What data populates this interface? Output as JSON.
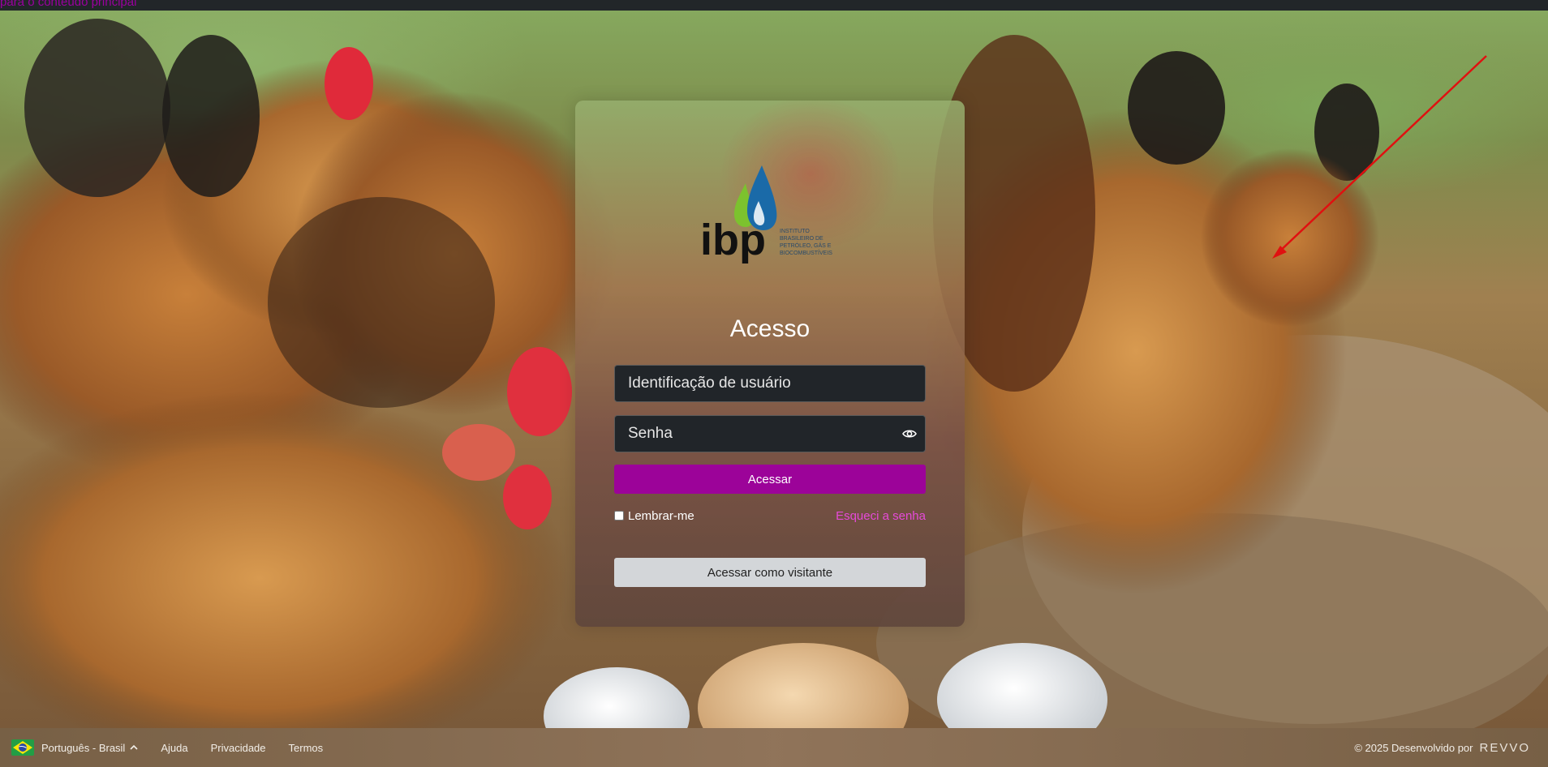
{
  "skip_link": "para o conteúdo principal",
  "login": {
    "title": "Acesso",
    "username_placeholder": "Identificação de usuário",
    "password_placeholder": "Senha",
    "submit_label": "Acessar",
    "remember_label": "Lembrar-me",
    "forgot_label": "Esqueci a senha",
    "visitor_label": "Acessar como visitante"
  },
  "logo": {
    "letters": "ibp",
    "tagline": [
      "INSTITUTO",
      "BRASILEIRO DE",
      "PETRÓLEO, GÁS E",
      "BIOCOMBUSTÍVEIS"
    ]
  },
  "footer": {
    "language": "Português - Brasil",
    "links": [
      "Ajuda",
      "Privacidade",
      "Termos"
    ],
    "copyright": "© 2025 Desenvolvido por",
    "brand": "REVVO"
  },
  "colors": {
    "primary": "#9c0399",
    "link": "#e64ad8",
    "input_bg": "#212529",
    "visitor_bg": "#d3d6d9"
  },
  "icons": [
    "eye-icon",
    "brazil-flag-icon",
    "chevron-up-icon"
  ]
}
